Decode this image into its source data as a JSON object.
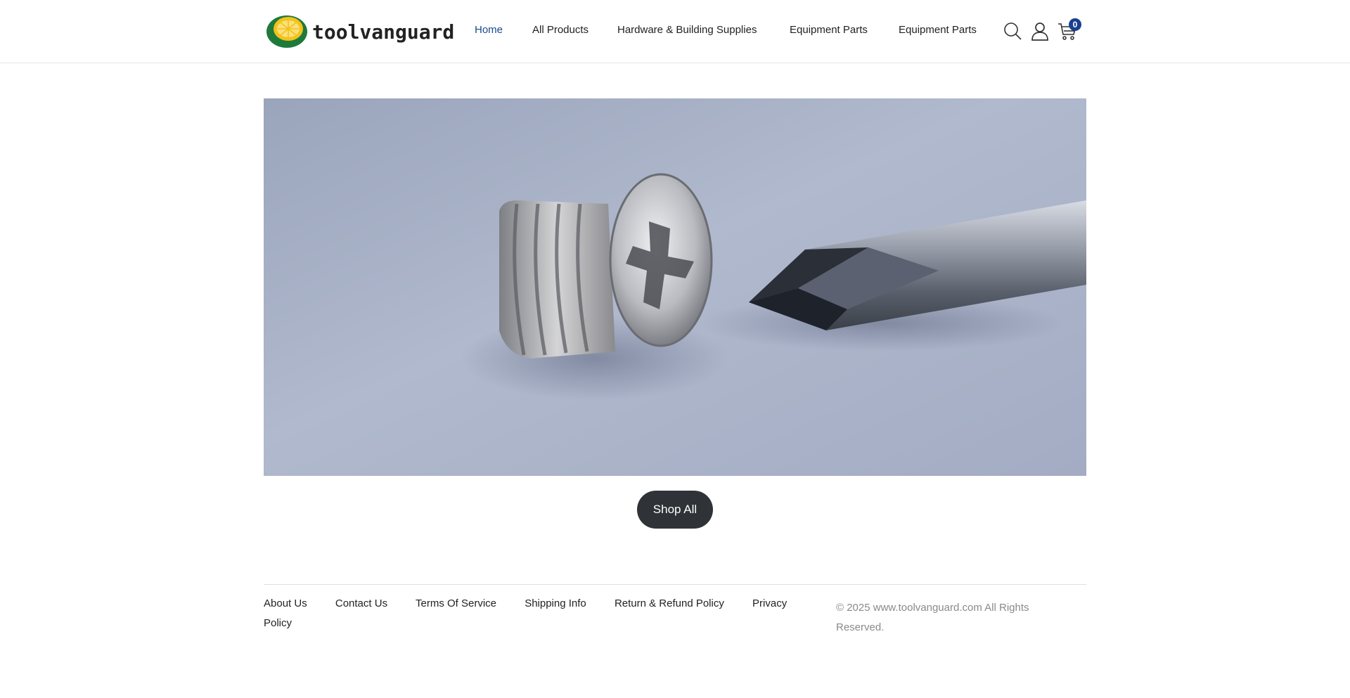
{
  "brand": {
    "name": "toolvanguard"
  },
  "nav": {
    "items": [
      {
        "label": "Home",
        "active": true
      },
      {
        "label": "All Products"
      },
      {
        "label": "Hardware & Building Supplies"
      },
      {
        "label": "Equipment Parts"
      },
      {
        "label": "Equipment Parts"
      }
    ]
  },
  "header_icons": {
    "search": "search-icon",
    "account": "user-icon",
    "cart": "cart-icon",
    "cart_count": "0"
  },
  "hero": {
    "image": "screw-and-screwdriver-photo"
  },
  "cta": {
    "label": "Shop All"
  },
  "footer": {
    "links": [
      "About Us",
      "Contact Us",
      "Terms Of Service",
      "Shipping Info",
      "Return & Refund Policy",
      "Privacy Policy"
    ],
    "copyright": "© 2025 www.toolvanguard.com All Rights Reserved."
  },
  "colors": {
    "accent": "#1a4a8a",
    "badge": "#1a3f8f",
    "button": "#2f3236",
    "logo_green": "#1e7a3a",
    "logo_yellow": "#f4c21b"
  }
}
